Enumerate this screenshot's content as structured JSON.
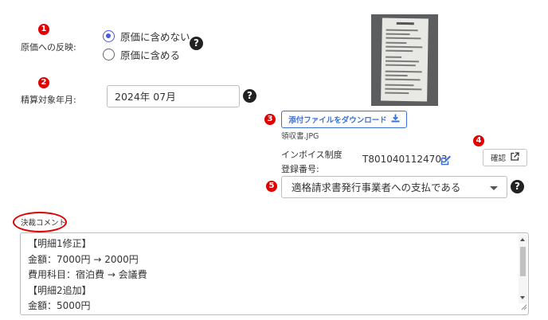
{
  "cost_reflection": {
    "badge": "1",
    "label": "原価への反映:",
    "options": [
      {
        "label": "原価に含めない",
        "checked": true
      },
      {
        "label": "原価に含める",
        "checked": false
      }
    ],
    "help": "?"
  },
  "settlement_month": {
    "badge": "2",
    "label": "精算対象年月:",
    "value": "2024年 07月",
    "help": "?"
  },
  "attachment": {
    "badge": "3",
    "download_label": "添付ファイルをダウンロード",
    "file_name": "領収書.JPG"
  },
  "invoice": {
    "badge": "4",
    "label_line1": "インボイス制度",
    "label_line2": "登録番号:",
    "number": "T8010401124703",
    "confirm_label": "確認"
  },
  "payment_type": {
    "badge": "5",
    "selected": "適格請求書発行事業者への支払である",
    "help": "?"
  },
  "comment": {
    "label": "決裁コメント",
    "lines": [
      "【明細1修正】",
      "金額：7000円 → 2000円",
      "費用科目：宿泊費 → 会議費",
      "【明細2追加】",
      "金額：5000円"
    ]
  },
  "colors": {
    "badge_red": "#e00000",
    "accent_blue": "#3b6fd8",
    "radio_checked": "#4a5ad8"
  }
}
